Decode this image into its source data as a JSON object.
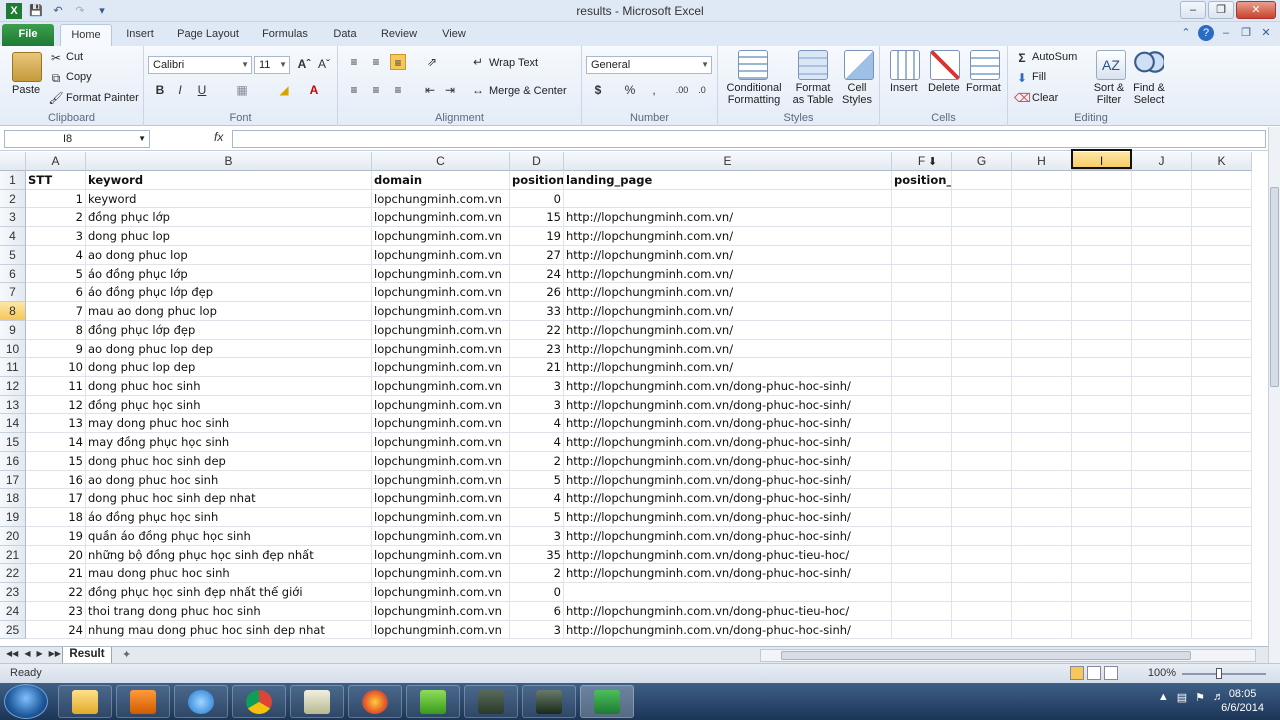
{
  "window": {
    "title": "results  -  Microsoft Excel"
  },
  "ribbon_tabs": [
    "File",
    "Home",
    "Insert",
    "Page Layout",
    "Formulas",
    "Data",
    "Review",
    "View"
  ],
  "clipboard": {
    "paste": "Paste",
    "cut": "Cut",
    "copy": "Copy",
    "format_painter": "Format Painter",
    "label": "Clipboard"
  },
  "font": {
    "name": "Calibri",
    "size": "11",
    "label": "Font"
  },
  "alignment": {
    "wrap": "Wrap Text",
    "merge": "Merge & Center",
    "label": "Alignment"
  },
  "number": {
    "format": "General",
    "label": "Number"
  },
  "styles": {
    "conditional": "Conditional",
    "conditional2": "Formatting",
    "format_table": "Format",
    "format_table2": "as Table",
    "cell_styles": "Cell",
    "cell_styles2": "Styles",
    "label": "Styles"
  },
  "cells": {
    "insert": "Insert",
    "delete": "Delete",
    "format": "Format",
    "label": "Cells"
  },
  "editing": {
    "autosum": "AutoSum",
    "fill": "Fill",
    "clear": "Clear",
    "sort": "Sort &",
    "sort2": "Filter",
    "find": "Find &",
    "find2": "Select",
    "label": "Editing"
  },
  "formula_bar": {
    "name_box": "I8",
    "fx": "fx",
    "value": ""
  },
  "columns": [
    "A",
    "B",
    "C",
    "D",
    "E",
    "F",
    "G",
    "H",
    "I",
    "J",
    "K"
  ],
  "rows": [
    [
      "STT",
      "keyword",
      "domain",
      "position",
      "landing_page",
      "position_old"
    ],
    [
      "1",
      "keyword",
      "lopchungminh.com.vn",
      "0",
      "",
      ""
    ],
    [
      "2",
      "đồng phục lớp",
      "lopchungminh.com.vn",
      "15",
      "http://lopchungminh.com.vn/",
      ""
    ],
    [
      "3",
      "dong phuc lop",
      "lopchungminh.com.vn",
      "19",
      "http://lopchungminh.com.vn/",
      ""
    ],
    [
      "4",
      "ao dong phuc lop",
      "lopchungminh.com.vn",
      "27",
      "http://lopchungminh.com.vn/",
      ""
    ],
    [
      "5",
      "áo đồng phục lớp",
      "lopchungminh.com.vn",
      "24",
      "http://lopchungminh.com.vn/",
      ""
    ],
    [
      "6",
      "áo đồng phục lớp đẹp",
      "lopchungminh.com.vn",
      "26",
      "http://lopchungminh.com.vn/",
      ""
    ],
    [
      "7",
      "mau ao dong phuc lop",
      "lopchungminh.com.vn",
      "33",
      "http://lopchungminh.com.vn/",
      ""
    ],
    [
      "8",
      "đồng phục lớp đẹp",
      "lopchungminh.com.vn",
      "22",
      "http://lopchungminh.com.vn/",
      ""
    ],
    [
      "9",
      "ao dong phuc lop dep",
      "lopchungminh.com.vn",
      "23",
      "http://lopchungminh.com.vn/",
      ""
    ],
    [
      "10",
      "dong phuc lop dep",
      "lopchungminh.com.vn",
      "21",
      "http://lopchungminh.com.vn/",
      ""
    ],
    [
      "11",
      "dong phuc hoc sinh",
      "lopchungminh.com.vn",
      "3",
      "http://lopchungminh.com.vn/dong-phuc-hoc-sinh/",
      ""
    ],
    [
      "12",
      "đồng phục học sinh",
      "lopchungminh.com.vn",
      "3",
      "http://lopchungminh.com.vn/dong-phuc-hoc-sinh/",
      ""
    ],
    [
      "13",
      "may dong phuc hoc sinh",
      "lopchungminh.com.vn",
      "4",
      "http://lopchungminh.com.vn/dong-phuc-hoc-sinh/",
      ""
    ],
    [
      "14",
      "may đồng phục học sinh",
      "lopchungminh.com.vn",
      "4",
      "http://lopchungminh.com.vn/dong-phuc-hoc-sinh/",
      ""
    ],
    [
      "15",
      "dong phuc hoc sinh dep",
      "lopchungminh.com.vn",
      "2",
      "http://lopchungminh.com.vn/dong-phuc-hoc-sinh/",
      ""
    ],
    [
      "16",
      "ao dong phuc hoc sinh",
      "lopchungminh.com.vn",
      "5",
      "http://lopchungminh.com.vn/dong-phuc-hoc-sinh/",
      ""
    ],
    [
      "17",
      "dong phuc hoc sinh dep nhat",
      "lopchungminh.com.vn",
      "4",
      "http://lopchungminh.com.vn/dong-phuc-hoc-sinh/",
      ""
    ],
    [
      "18",
      "áo đồng phục học sinh",
      "lopchungminh.com.vn",
      "5",
      "http://lopchungminh.com.vn/dong-phuc-hoc-sinh/",
      ""
    ],
    [
      "19",
      "quần áo đồng phục học sinh",
      "lopchungminh.com.vn",
      "3",
      "http://lopchungminh.com.vn/dong-phuc-hoc-sinh/",
      ""
    ],
    [
      "20",
      "những bộ đồng phục học sinh đẹp nhất",
      "lopchungminh.com.vn",
      "35",
      "http://lopchungminh.com.vn/dong-phuc-tieu-hoc/",
      ""
    ],
    [
      "21",
      "mau dong phuc hoc sinh",
      "lopchungminh.com.vn",
      "2",
      "http://lopchungminh.com.vn/dong-phuc-hoc-sinh/",
      ""
    ],
    [
      "22",
      "đồng phục học sinh đẹp nhất thế giới",
      "lopchungminh.com.vn",
      "0",
      "",
      ""
    ],
    [
      "23",
      "thoi trang dong phuc hoc sinh",
      "lopchungminh.com.vn",
      "6",
      "http://lopchungminh.com.vn/dong-phuc-tieu-hoc/",
      ""
    ],
    [
      "24",
      "nhung mau dong phuc hoc sinh dep nhat",
      "lopchungminh.com.vn",
      "3",
      "http://lopchungminh.com.vn/dong-phuc-hoc-sinh/",
      ""
    ]
  ],
  "sheet": {
    "tab": "Result"
  },
  "status": {
    "text": "Ready",
    "zoom": "100%"
  },
  "clock": {
    "time": "08:05",
    "date": "6/6/2014"
  }
}
